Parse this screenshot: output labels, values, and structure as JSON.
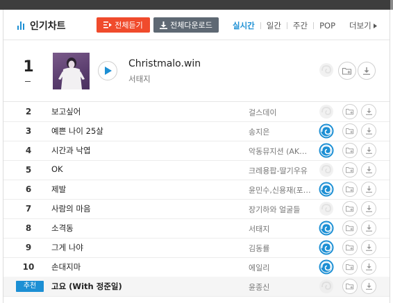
{
  "header": {
    "title": "인기차트",
    "play_all_label": "전체듣기",
    "download_all_label": "전체다운로드",
    "tabs": [
      {
        "label": "실시간",
        "active": true
      },
      {
        "label": "일간",
        "active": false
      },
      {
        "label": "주간",
        "active": false
      },
      {
        "label": "POP",
        "active": false
      }
    ],
    "more_label": "더보기"
  },
  "top_item": {
    "rank": "1",
    "change": "–",
    "title": "Christmalo.win",
    "artist": "서태지"
  },
  "rows": [
    {
      "rank": "2",
      "title": "보고싶어",
      "artist": "걸스데이",
      "pado": false
    },
    {
      "rank": "3",
      "title": "예쁜 나이 25살",
      "artist": "송지은",
      "pado": true
    },
    {
      "rank": "4",
      "title": "시간과 낙엽",
      "artist": "악동뮤지션 (AKMU)",
      "pado": true
    },
    {
      "rank": "5",
      "title": "OK",
      "artist": "크레용팝-딸기우유",
      "pado": false
    },
    {
      "rank": "6",
      "title": "제발",
      "artist": "윤민수,신용재(포맨)",
      "pado": true
    },
    {
      "rank": "7",
      "title": "사람의 마음",
      "artist": "장기하와 얼굴들",
      "pado": false
    },
    {
      "rank": "8",
      "title": "소격동",
      "artist": "서태지",
      "pado": true
    },
    {
      "rank": "9",
      "title": "그게 나야",
      "artist": "김동률",
      "pado": true
    },
    {
      "rank": "10",
      "title": "손대지마",
      "artist": "에일리",
      "pado": true
    }
  ],
  "recommended": {
    "badge": "추천",
    "title": "고요 (With 정준일)",
    "artist": "윤종신",
    "pado": false
  },
  "colors": {
    "accent_blue": "#1c8fd4",
    "play_all_red": "#f04b2c",
    "download_gray": "#5e6873"
  },
  "icons": {
    "play": "play-icon",
    "add": "add-to-playlist-icon",
    "download": "download-icon",
    "pado": "pado-icon"
  }
}
